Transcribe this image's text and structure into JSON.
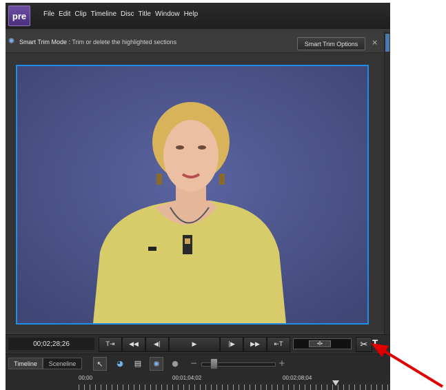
{
  "app": {
    "logo": "pre",
    "menu": [
      "File",
      "Edit",
      "Clip",
      "Timeline",
      "Disc",
      "Title",
      "Window",
      "Help"
    ]
  },
  "smart_trim": {
    "mode_label": "Smart Trim Mode :",
    "message": "Trim or delete the highlighted sections",
    "options_button": "Smart Trim Options",
    "close": "×"
  },
  "transport": {
    "timecode": "00;02;28;26",
    "buttons": {
      "go_to_start": "T⇥",
      "rewind": "◀◀",
      "step_back": "◀|",
      "play": "▶",
      "step_forward": "|▶",
      "fast_forward": "▶▶",
      "go_to_end": "⇤T"
    },
    "jog_label": "◂‖▸",
    "scissors": "✂",
    "text_tool": "T"
  },
  "timeline_bar": {
    "tabs": [
      "Timeline",
      "Sceneline"
    ],
    "zoom_minus": "−",
    "zoom_plus": "+",
    "zoom_level": 0.2
  },
  "ruler": {
    "labels": [
      "00;00",
      "00;01;04;02",
      "00;02;08;04"
    ]
  },
  "colors": {
    "accent": "#1f8ee8",
    "logo": "#5b3f92",
    "arrow": "#e00000"
  },
  "icons": {
    "trim": "smart-trim-icon",
    "selection": "selection-tool-icon",
    "smartfix": "smartfix-icon",
    "list": "list-icon",
    "smarttrim_tool": "smart-trim-tool-icon",
    "audio": "audio-icon"
  }
}
